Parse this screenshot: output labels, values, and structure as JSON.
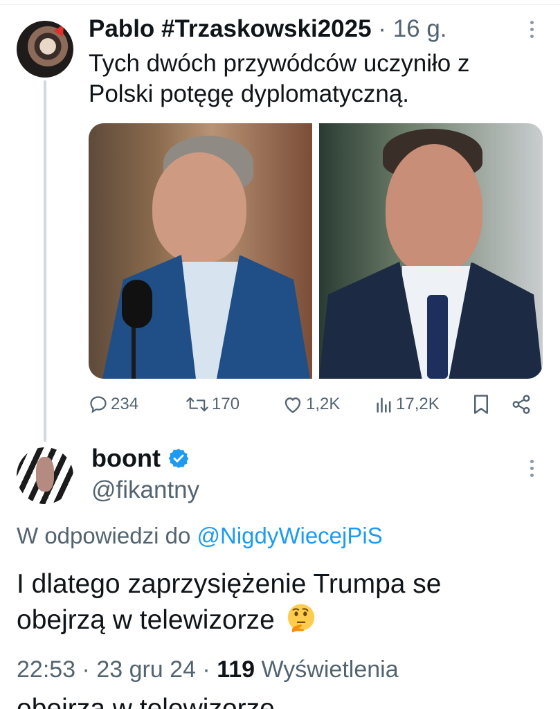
{
  "parent_tweet": {
    "name": "Pablo #Trzaskowski2025",
    "separator": " · ",
    "age": "16 g.",
    "text": "Tych dwóch przywódców uczyniło z Polski potęgę dyplomatyczną.",
    "stats": {
      "replies": "234",
      "reposts": "170",
      "likes": "1,2K",
      "views": "17,2K"
    }
  },
  "reply_tweet": {
    "name": "boont",
    "handle": "@fikantny",
    "reply_prefix": "W odpowiedzi do ",
    "reply_mention": "@NigdyWiecejPiS",
    "text": "I dlatego zaprzysiężenie Trumpa se obejrzą w telewizorze",
    "emoji": "thinking-face",
    "time": "22:53",
    "date": "23 gru 24",
    "views_count": "119",
    "views_label": "Wyświetlenia",
    "meta_sep": " · "
  },
  "cut_off_text": "obejrzą w telewizorze",
  "colors": {
    "text": "#0f1419",
    "secondary": "#536471",
    "accent": "#1d9bf0",
    "thread_line": "#cfd9de"
  }
}
